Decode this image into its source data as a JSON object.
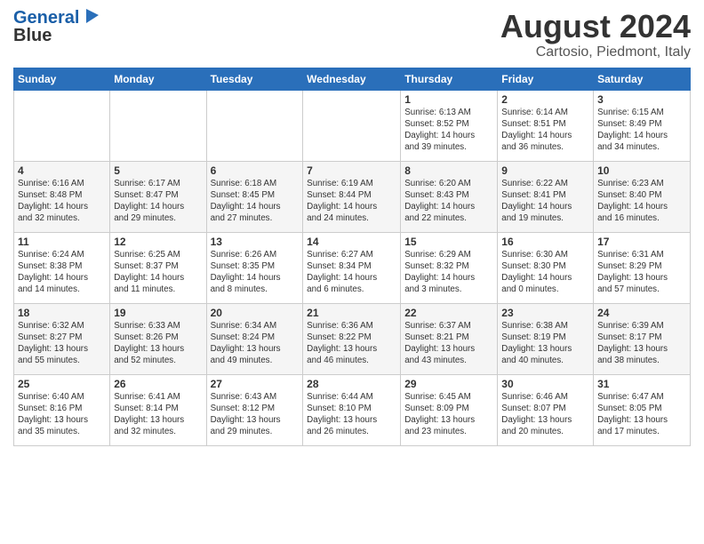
{
  "header": {
    "logo_line1": "General",
    "logo_line2": "Blue",
    "main_title": "August 2024",
    "subtitle": "Cartosio, Piedmont, Italy"
  },
  "days_of_week": [
    "Sunday",
    "Monday",
    "Tuesday",
    "Wednesday",
    "Thursday",
    "Friday",
    "Saturday"
  ],
  "weeks": [
    [
      {
        "day": "",
        "info": ""
      },
      {
        "day": "",
        "info": ""
      },
      {
        "day": "",
        "info": ""
      },
      {
        "day": "",
        "info": ""
      },
      {
        "day": "1",
        "info": "Sunrise: 6:13 AM\nSunset: 8:52 PM\nDaylight: 14 hours\nand 39 minutes."
      },
      {
        "day": "2",
        "info": "Sunrise: 6:14 AM\nSunset: 8:51 PM\nDaylight: 14 hours\nand 36 minutes."
      },
      {
        "day": "3",
        "info": "Sunrise: 6:15 AM\nSunset: 8:49 PM\nDaylight: 14 hours\nand 34 minutes."
      }
    ],
    [
      {
        "day": "4",
        "info": "Sunrise: 6:16 AM\nSunset: 8:48 PM\nDaylight: 14 hours\nand 32 minutes."
      },
      {
        "day": "5",
        "info": "Sunrise: 6:17 AM\nSunset: 8:47 PM\nDaylight: 14 hours\nand 29 minutes."
      },
      {
        "day": "6",
        "info": "Sunrise: 6:18 AM\nSunset: 8:45 PM\nDaylight: 14 hours\nand 27 minutes."
      },
      {
        "day": "7",
        "info": "Sunrise: 6:19 AM\nSunset: 8:44 PM\nDaylight: 14 hours\nand 24 minutes."
      },
      {
        "day": "8",
        "info": "Sunrise: 6:20 AM\nSunset: 8:43 PM\nDaylight: 14 hours\nand 22 minutes."
      },
      {
        "day": "9",
        "info": "Sunrise: 6:22 AM\nSunset: 8:41 PM\nDaylight: 14 hours\nand 19 minutes."
      },
      {
        "day": "10",
        "info": "Sunrise: 6:23 AM\nSunset: 8:40 PM\nDaylight: 14 hours\nand 16 minutes."
      }
    ],
    [
      {
        "day": "11",
        "info": "Sunrise: 6:24 AM\nSunset: 8:38 PM\nDaylight: 14 hours\nand 14 minutes."
      },
      {
        "day": "12",
        "info": "Sunrise: 6:25 AM\nSunset: 8:37 PM\nDaylight: 14 hours\nand 11 minutes."
      },
      {
        "day": "13",
        "info": "Sunrise: 6:26 AM\nSunset: 8:35 PM\nDaylight: 14 hours\nand 8 minutes."
      },
      {
        "day": "14",
        "info": "Sunrise: 6:27 AM\nSunset: 8:34 PM\nDaylight: 14 hours\nand 6 minutes."
      },
      {
        "day": "15",
        "info": "Sunrise: 6:29 AM\nSunset: 8:32 PM\nDaylight: 14 hours\nand 3 minutes."
      },
      {
        "day": "16",
        "info": "Sunrise: 6:30 AM\nSunset: 8:30 PM\nDaylight: 14 hours\nand 0 minutes."
      },
      {
        "day": "17",
        "info": "Sunrise: 6:31 AM\nSunset: 8:29 PM\nDaylight: 13 hours\nand 57 minutes."
      }
    ],
    [
      {
        "day": "18",
        "info": "Sunrise: 6:32 AM\nSunset: 8:27 PM\nDaylight: 13 hours\nand 55 minutes."
      },
      {
        "day": "19",
        "info": "Sunrise: 6:33 AM\nSunset: 8:26 PM\nDaylight: 13 hours\nand 52 minutes."
      },
      {
        "day": "20",
        "info": "Sunrise: 6:34 AM\nSunset: 8:24 PM\nDaylight: 13 hours\nand 49 minutes."
      },
      {
        "day": "21",
        "info": "Sunrise: 6:36 AM\nSunset: 8:22 PM\nDaylight: 13 hours\nand 46 minutes."
      },
      {
        "day": "22",
        "info": "Sunrise: 6:37 AM\nSunset: 8:21 PM\nDaylight: 13 hours\nand 43 minutes."
      },
      {
        "day": "23",
        "info": "Sunrise: 6:38 AM\nSunset: 8:19 PM\nDaylight: 13 hours\nand 40 minutes."
      },
      {
        "day": "24",
        "info": "Sunrise: 6:39 AM\nSunset: 8:17 PM\nDaylight: 13 hours\nand 38 minutes."
      }
    ],
    [
      {
        "day": "25",
        "info": "Sunrise: 6:40 AM\nSunset: 8:16 PM\nDaylight: 13 hours\nand 35 minutes."
      },
      {
        "day": "26",
        "info": "Sunrise: 6:41 AM\nSunset: 8:14 PM\nDaylight: 13 hours\nand 32 minutes."
      },
      {
        "day": "27",
        "info": "Sunrise: 6:43 AM\nSunset: 8:12 PM\nDaylight: 13 hours\nand 29 minutes."
      },
      {
        "day": "28",
        "info": "Sunrise: 6:44 AM\nSunset: 8:10 PM\nDaylight: 13 hours\nand 26 minutes."
      },
      {
        "day": "29",
        "info": "Sunrise: 6:45 AM\nSunset: 8:09 PM\nDaylight: 13 hours\nand 23 minutes."
      },
      {
        "day": "30",
        "info": "Sunrise: 6:46 AM\nSunset: 8:07 PM\nDaylight: 13 hours\nand 20 minutes."
      },
      {
        "day": "31",
        "info": "Sunrise: 6:47 AM\nSunset: 8:05 PM\nDaylight: 13 hours\nand 17 minutes."
      }
    ]
  ]
}
